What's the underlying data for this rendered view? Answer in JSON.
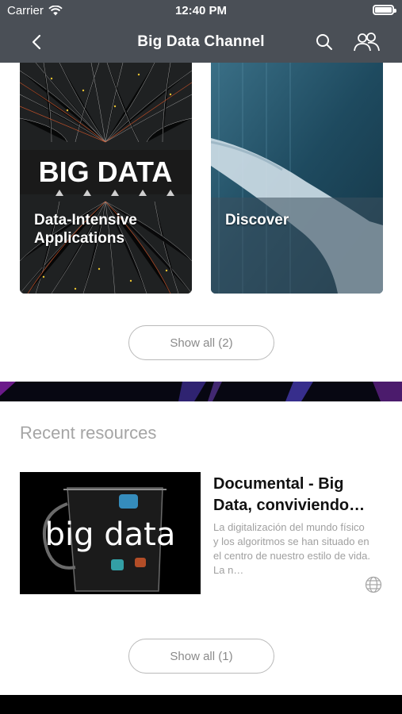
{
  "status_bar": {
    "carrier": "Carrier",
    "time": "12:40 PM"
  },
  "nav": {
    "title": "Big Data Channel"
  },
  "cards": [
    {
      "label": "Data-Intensive Applications",
      "art_text": "BIG DATA"
    },
    {
      "label": "Discover"
    }
  ],
  "cards_show_all": "Show all (2)",
  "recent": {
    "title": "Recent resources",
    "items": [
      {
        "thumb_text": "big data",
        "title": "Documental - Big Data, conviviendo…",
        "description": "La digitalización del mundo físico y los algoritmos se han situado en el centro de nuestro estilo de vida. La n…"
      }
    ],
    "show_all": "Show all (1)"
  }
}
